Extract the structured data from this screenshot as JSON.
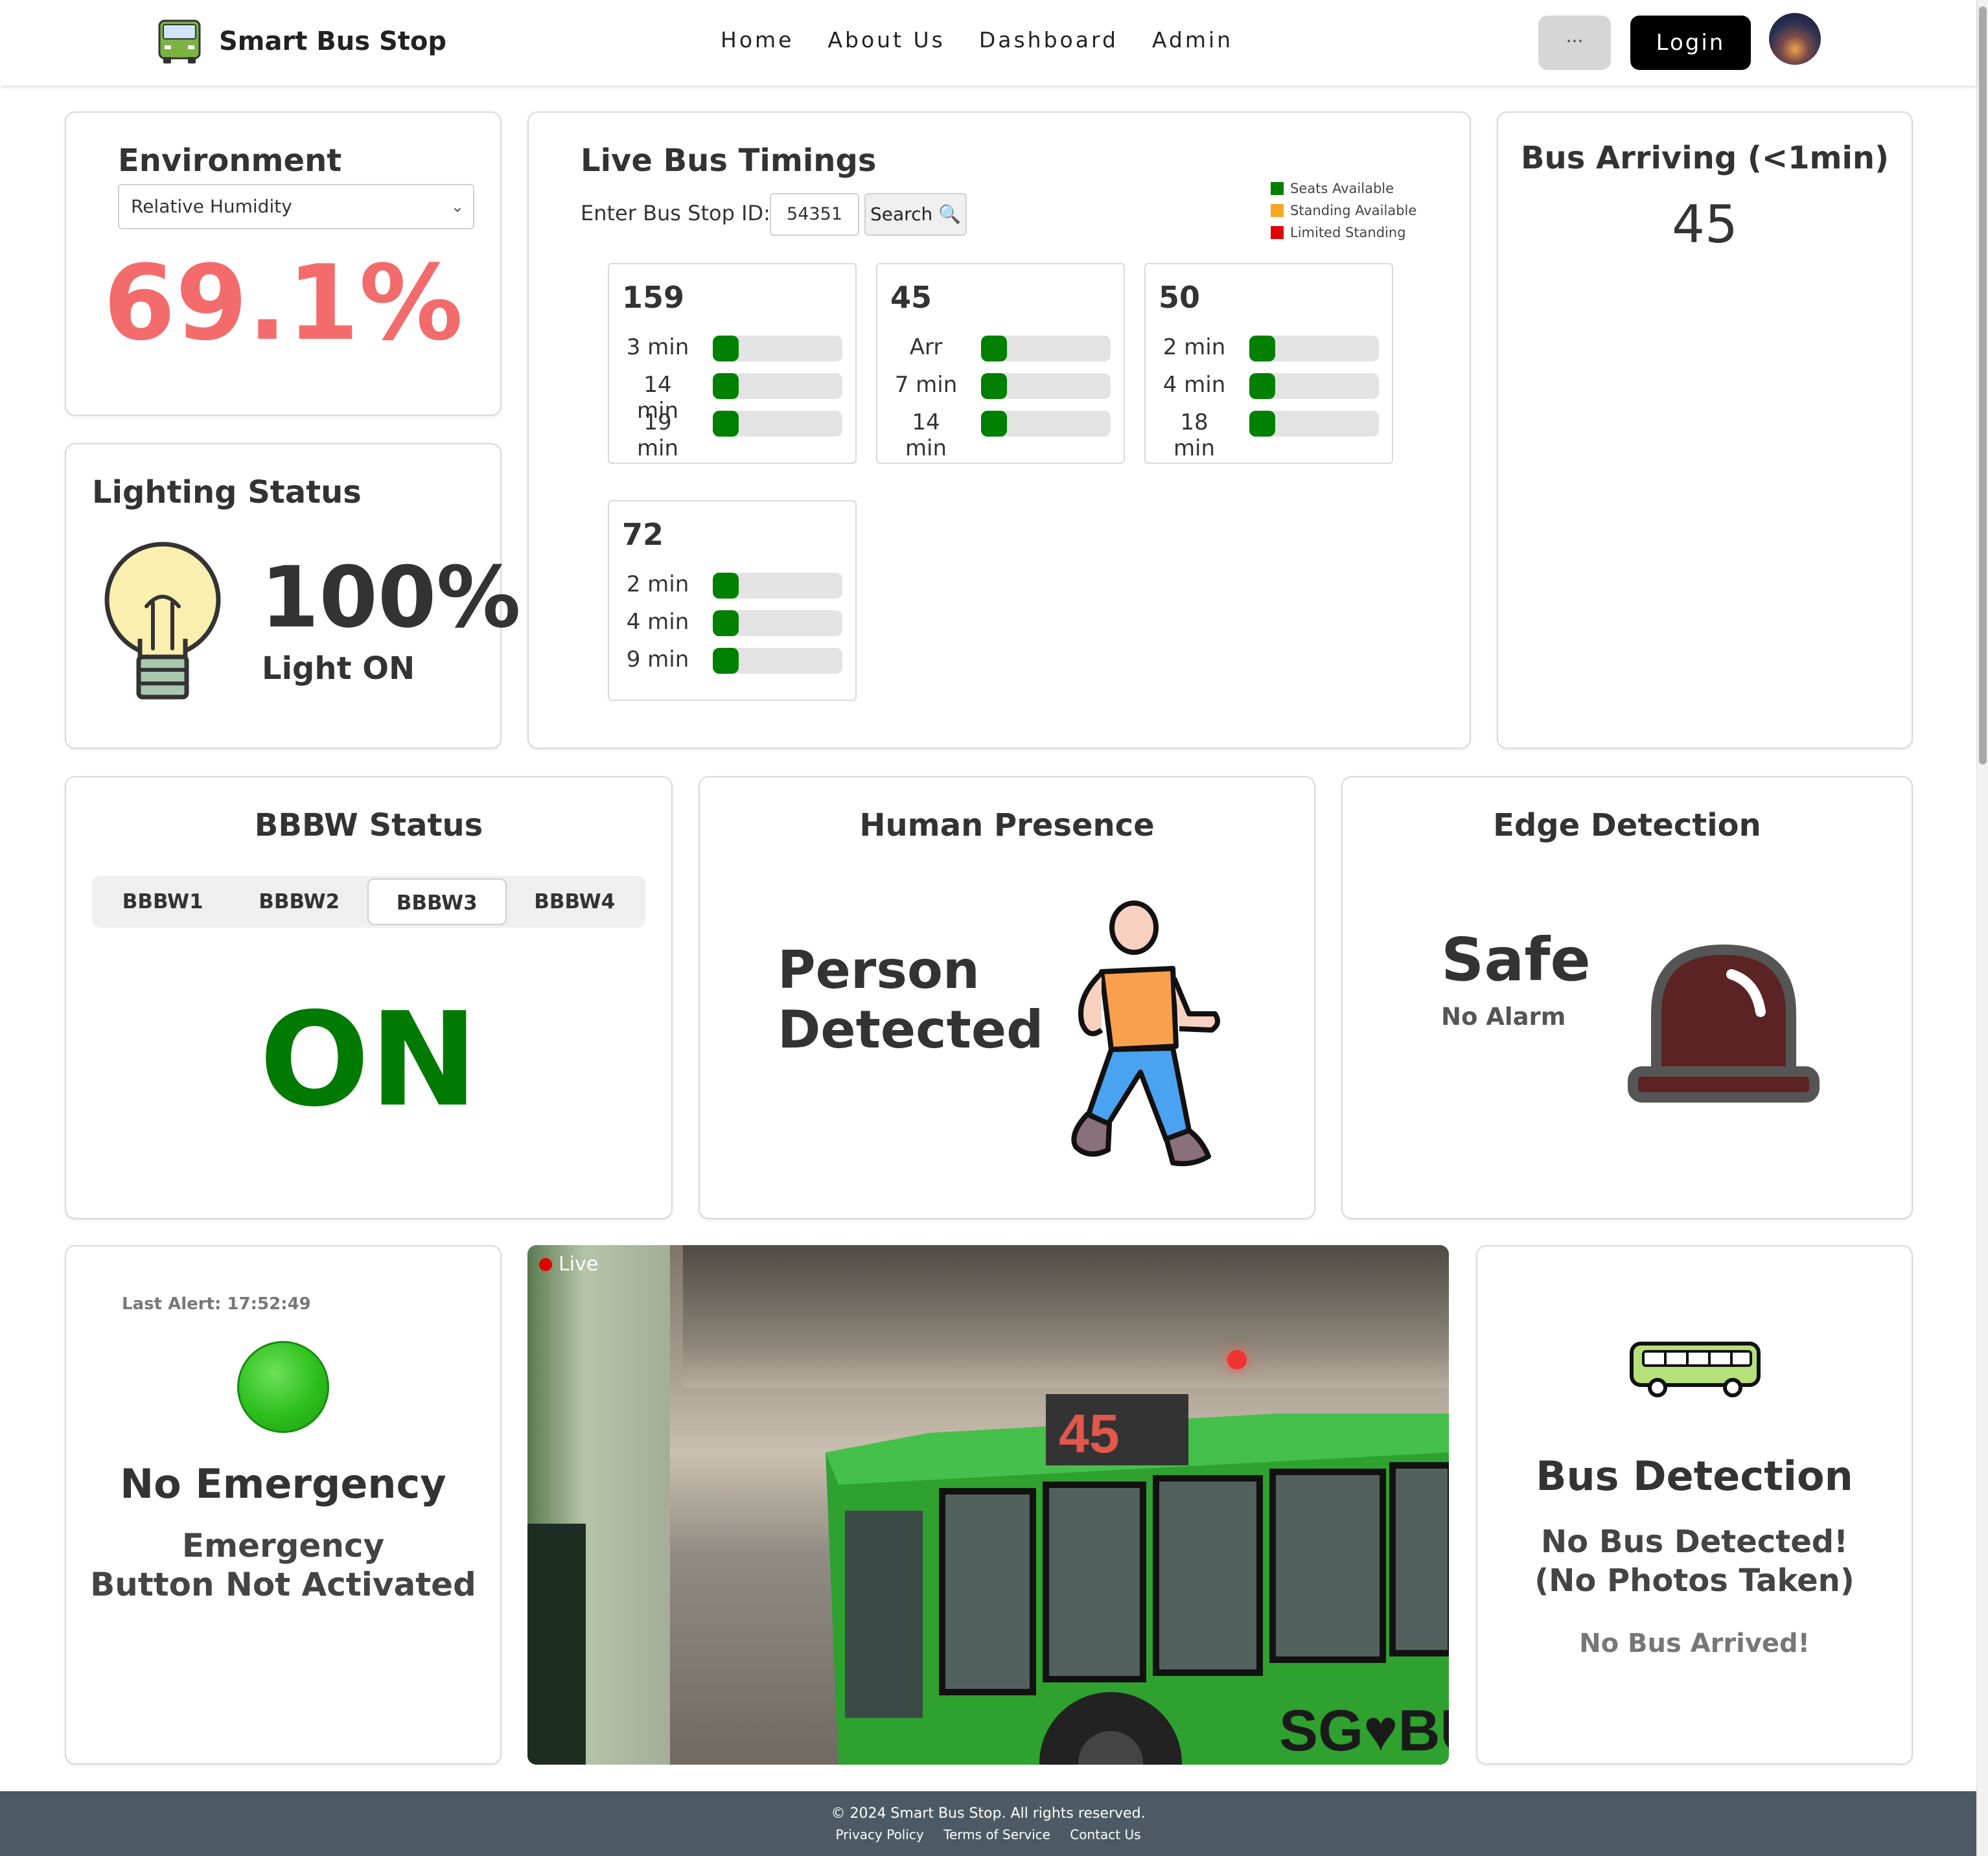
{
  "header": {
    "brand": "Smart Bus Stop",
    "nav": [
      "Home",
      "About Us",
      "Dashboard",
      "Admin"
    ],
    "more_label": "···",
    "login_label": "Login"
  },
  "environment": {
    "title": "Environment",
    "selected": "Relative Humidity",
    "value": "69.1%"
  },
  "lighting": {
    "title": "Lighting Status",
    "percent": "100%",
    "status": "Light ON"
  },
  "timings": {
    "title": "Live Bus Timings",
    "stop_label": "Enter Bus Stop ID:",
    "stop_id": "54351",
    "search_label": "Search 🔍",
    "legend": [
      {
        "label": "Seats Available",
        "color": "#008000"
      },
      {
        "label": "Standing Available",
        "color": "#f5a623"
      },
      {
        "label": "Limited Standing",
        "color": "#e00000"
      }
    ],
    "buses": [
      {
        "number": "159",
        "arrivals": [
          {
            "eta": "3 min",
            "load": 0.2
          },
          {
            "eta": "14 min",
            "load": 0.2
          },
          {
            "eta": "19 min",
            "load": 0.2
          }
        ]
      },
      {
        "number": "45",
        "arrivals": [
          {
            "eta": "Arr",
            "load": 0.2
          },
          {
            "eta": "7 min",
            "load": 0.2
          },
          {
            "eta": "14 min",
            "load": 0.2
          }
        ]
      },
      {
        "number": "50",
        "arrivals": [
          {
            "eta": "2 min",
            "load": 0.2
          },
          {
            "eta": "4 min",
            "load": 0.2
          },
          {
            "eta": "18 min",
            "load": 0.2
          }
        ]
      },
      {
        "number": "72",
        "arrivals": [
          {
            "eta": "2 min",
            "load": 0.2
          },
          {
            "eta": "4 min",
            "load": 0.2
          },
          {
            "eta": "9 min",
            "load": 0.2
          }
        ]
      }
    ]
  },
  "arriving": {
    "title": "Bus Arriving (<1min)",
    "value": "45"
  },
  "bbbw": {
    "title": "BBBW Status",
    "tabs": [
      "BBBW1",
      "BBBW2",
      "BBBW3",
      "BBBW4"
    ],
    "active_tab": "BBBW3",
    "state": "ON"
  },
  "human": {
    "title": "Human Presence",
    "status_line1": "Person",
    "status_line2": "Detected"
  },
  "edge": {
    "title": "Edge Detection",
    "status": "Safe",
    "sub": "No Alarm"
  },
  "emergency": {
    "last_alert": "Last Alert: 17:52:49",
    "title": "No Emergency",
    "line1": "Emergency",
    "line2": "Button Not Activated"
  },
  "camera": {
    "live_label": "Live",
    "route_sign": "45",
    "bus_livery": "SG♥BUS"
  },
  "detection": {
    "title": "Bus Detection",
    "line1": "No Bus Detected!",
    "line2": "(No Photos Taken)",
    "line3": "No Bus Arrived!"
  },
  "footer": {
    "copyright": "© 2024 Smart Bus Stop. All rights reserved.",
    "links": [
      "Privacy Policy",
      "Terms of Service",
      "Contact Us"
    ]
  }
}
